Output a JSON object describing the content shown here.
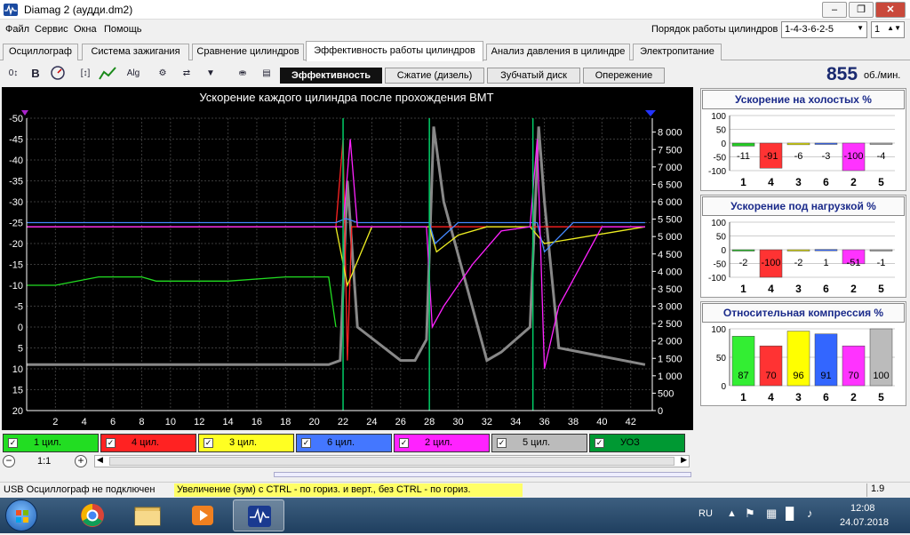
{
  "window": {
    "title": "Diamag 2 (аудди.dm2)"
  },
  "menu": {
    "file": "Файл",
    "service": "Сервис",
    "windows": "Окна",
    "help": "Помощь"
  },
  "cylinder_order": {
    "label": "Порядок работы цилиндров",
    "value": "1-4-3-6-2-5",
    "count": "1"
  },
  "tabs": [
    "Осциллограф",
    "Система зажигания",
    "Сравнение цилиндров",
    "Эффективность работы цилиндров",
    "Анализ давления в цилиндре",
    "Электропитание"
  ],
  "active_tab": 3,
  "subtabs": [
    "Эффективность",
    "Сжатие (дизель)",
    "Зубчатый диск",
    "Опережение"
  ],
  "toolbar": {
    "rpm_value": "855",
    "rpm_unit": "об./мин."
  },
  "chart_data": {
    "type": "line",
    "title": "Ускорение каждого цилиндра после прохождения ВМТ",
    "x_ticks": [
      "2",
      "4",
      "6",
      "8",
      "10",
      "12",
      "14",
      "16",
      "18",
      "20",
      "22",
      "24",
      "26",
      "28",
      "30",
      "32",
      "34",
      "36",
      "38",
      "40",
      "42"
    ],
    "x_range": [
      0,
      43.5
    ],
    "left_axis": {
      "ticks": [
        "-50",
        "-45",
        "-40",
        "-35",
        "-30",
        "-25",
        "-20",
        "-15",
        "-10",
        "-5",
        "0",
        "5",
        "10",
        "15",
        "20"
      ],
      "range": [
        -50,
        20
      ],
      "reversed": true
    },
    "right_axis": {
      "ticks": [
        "8 000",
        "7 500",
        "7 000",
        "6 500",
        "6 000",
        "5 500",
        "5 000",
        "4 500",
        "4 000",
        "3 500",
        "3 000",
        "2 500",
        "2 000",
        "1 500",
        "1 000",
        "500",
        "0"
      ],
      "range": [
        0,
        8400
      ]
    },
    "series": [
      {
        "name": "1 цил.",
        "color": "#22dd22",
        "x": [
          0,
          2,
          5,
          8,
          9,
          11,
          14,
          18,
          20,
          21,
          21.5
        ],
        "y": [
          -10,
          -10,
          -12,
          -12,
          -11,
          -11,
          -11,
          -12,
          -12,
          -12,
          0
        ]
      },
      {
        "name": "4 цил.",
        "color": "#ff2222",
        "x": [
          0,
          10,
          20,
          21.5,
          22,
          22.3,
          22.6,
          30,
          40,
          43
        ],
        "y": [
          -24,
          -24,
          -24,
          -24,
          -45,
          8,
          -24,
          -24,
          -24,
          -24
        ]
      },
      {
        "name": "3 цил.",
        "color": "#eeee22",
        "x": [
          0,
          10,
          20,
          21.5,
          22.3,
          24,
          28,
          28.5,
          30,
          32,
          35,
          36,
          43
        ],
        "y": [
          -24,
          -24,
          -24,
          -24,
          -10,
          -24,
          -24,
          -18,
          -22,
          -24,
          -24,
          -20,
          -24
        ]
      },
      {
        "name": "6 цил.",
        "color": "#4488ff",
        "x": [
          0,
          10,
          21.5,
          22.2,
          23,
          28,
          28.4,
          30,
          32,
          35.5,
          36,
          38,
          43
        ],
        "y": [
          -25,
          -25,
          -25,
          -26,
          -25,
          -25,
          -20,
          -25,
          -25,
          -25,
          -18,
          -25,
          -25
        ]
      },
      {
        "name": "2 цил.",
        "color": "#ff22ff",
        "x": [
          0,
          10,
          20,
          22,
          22.5,
          23,
          27.8,
          28.2,
          29,
          31,
          33,
          35,
          35.5,
          36,
          37,
          40,
          43
        ],
        "y": [
          -24,
          -24,
          -24,
          -24,
          -45,
          -24,
          -24,
          0,
          -5,
          -15,
          -23,
          -24,
          -45,
          10,
          -5,
          -24,
          -24
        ]
      },
      {
        "name": "5 цил.",
        "color": "#888888",
        "x": [
          0,
          21,
          21.8,
          22.3,
          23,
          26,
          27,
          27.8,
          28.3,
          29,
          32,
          33,
          35,
          35.6,
          36,
          37,
          43
        ],
        "y": [
          9,
          9,
          8,
          -35,
          0,
          8,
          8,
          3,
          -48,
          -30,
          8,
          6,
          0,
          -48,
          -30,
          5,
          9
        ]
      },
      {
        "name": "УОЗ",
        "color": "#00cc66",
        "x": [
          22,
          22,
          28,
          28,
          35.2,
          35.2
        ],
        "y": [
          -50,
          20,
          -50,
          20,
          -50,
          20
        ]
      }
    ]
  },
  "legend": [
    {
      "label": "1 цил.",
      "color": "#22dd22"
    },
    {
      "label": "4 цил.",
      "color": "#ff2222"
    },
    {
      "label": "3 цил.",
      "color": "#ffff22"
    },
    {
      "label": "6 цил.",
      "color": "#4477ff"
    },
    {
      "label": "2 цил.",
      "color": "#ff22ff"
    },
    {
      "label": "5 цил.",
      "color": "#bbbbbb"
    },
    {
      "label": "УОЗ",
      "color": "#009933"
    }
  ],
  "zoom": {
    "value": "1:1"
  },
  "panels": [
    {
      "title": "Ускорение на холостых %",
      "y_ticks": [
        "100",
        "50",
        "0",
        "-50",
        "-100"
      ],
      "ylim": [
        -100,
        100
      ],
      "bars": [
        {
          "cyl": "1",
          "value": -11,
          "color": "#22cc22"
        },
        {
          "cyl": "4",
          "value": -91,
          "color": "#ff3333"
        },
        {
          "cyl": "3",
          "value": -6,
          "color": "#e8e800"
        },
        {
          "cyl": "6",
          "value": -3,
          "color": "#3366ff"
        },
        {
          "cyl": "2",
          "value": -100,
          "color": "#ff33ff"
        },
        {
          "cyl": "5",
          "value": -4,
          "color": "#aaaaaa"
        }
      ]
    },
    {
      "title": "Ускорение под нагрузкой %",
      "y_ticks": [
        "100",
        "50",
        "0",
        "-50",
        "-100"
      ],
      "ylim": [
        -100,
        100
      ],
      "bars": [
        {
          "cyl": "1",
          "value": -2,
          "color": "#22cc22"
        },
        {
          "cyl": "4",
          "value": -100,
          "color": "#ff3333"
        },
        {
          "cyl": "3",
          "value": -2,
          "color": "#e8e800"
        },
        {
          "cyl": "6",
          "value": 1,
          "color": "#3366ff"
        },
        {
          "cyl": "2",
          "value": -51,
          "color": "#ff33ff"
        },
        {
          "cyl": "5",
          "value": -1,
          "color": "#aaaaaa"
        }
      ]
    },
    {
      "title": "Относительная компрессия %",
      "y_ticks": [
        "100",
        "50",
        "0"
      ],
      "ylim": [
        0,
        100
      ],
      "bars": [
        {
          "cyl": "1",
          "value": 87,
          "color": "#33ee33"
        },
        {
          "cyl": "4",
          "value": 70,
          "color": "#ff3333"
        },
        {
          "cyl": "3",
          "value": 96,
          "color": "#ffff00"
        },
        {
          "cyl": "6",
          "value": 91,
          "color": "#3366ff"
        },
        {
          "cyl": "2",
          "value": 70,
          "color": "#ff33ff"
        },
        {
          "cyl": "5",
          "value": 100,
          "color": "#bbbbbb"
        }
      ]
    }
  ],
  "status": {
    "left": "USB Осциллограф не подключен",
    "hint": "Увеличение (зум) с CTRL - по гориз. и верт., без CTRL - по гориз.",
    "version": "1.9"
  },
  "tray": {
    "lang": "RU",
    "time": "12:08",
    "date": "24.07.2018"
  }
}
